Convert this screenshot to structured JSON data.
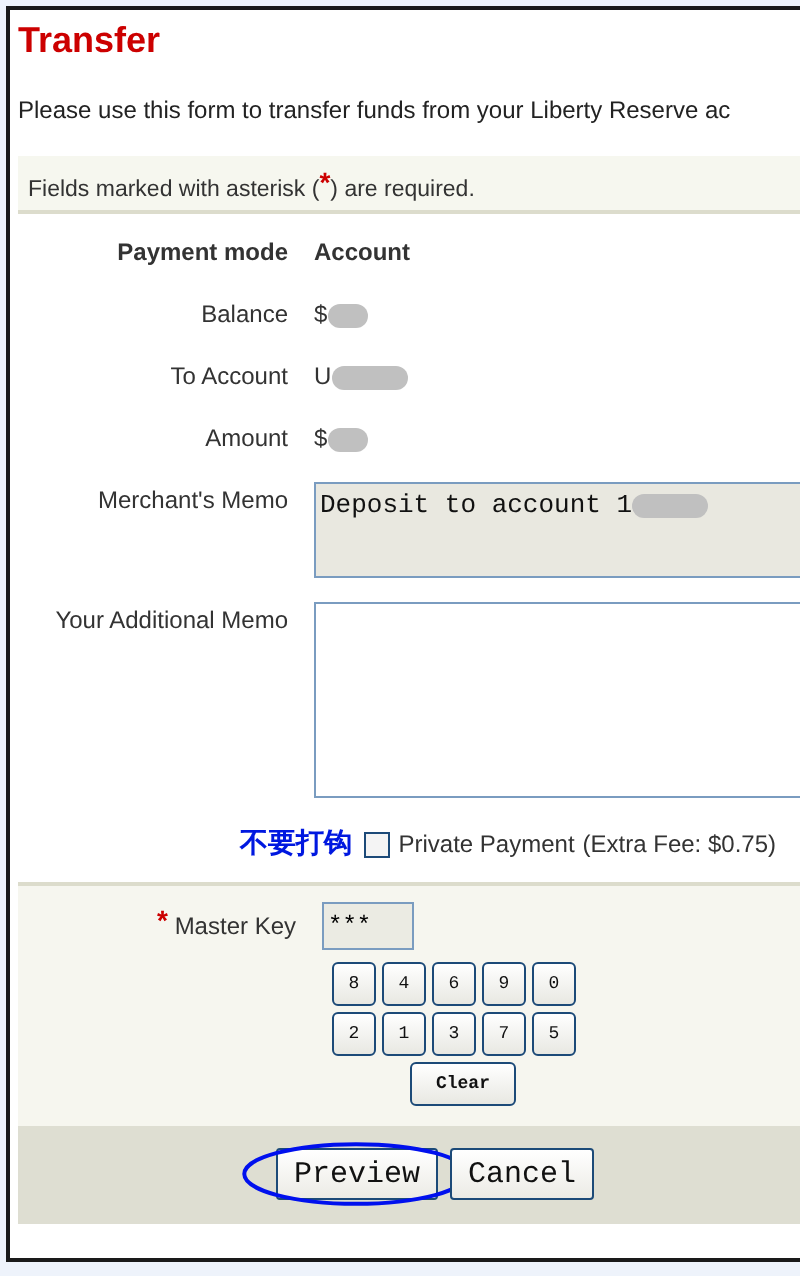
{
  "title": "Transfer",
  "intro": "Please use this form to transfer funds from your Liberty Reserve ac",
  "notice": {
    "before": "Fields marked with asterisk (",
    "mark": "*",
    "after": ") are required."
  },
  "fields": [
    {
      "kind": "heading",
      "label": "Payment mode",
      "value": "Account",
      "redacted": false
    },
    {
      "kind": "text",
      "label": "Balance",
      "value": "$",
      "redacted": true
    },
    {
      "kind": "text",
      "label": "To Account",
      "value": "U",
      "redacted": true
    },
    {
      "kind": "text",
      "label": "Amount",
      "value": "$",
      "redacted": true
    }
  ],
  "merchant_memo": {
    "label": "Merchant's Memo",
    "value": "Deposit to account 1",
    "redacted": true
  },
  "additional_memo": {
    "label": "Your Additional Memo"
  },
  "annotation": "不要打钩",
  "private_payment": {
    "label": "Private Payment",
    "checked": false,
    "fee": "(Extra Fee: $0.75)"
  },
  "master_key": {
    "required_mark": "*",
    "label": "Master Key",
    "value": "***"
  },
  "keypad": [
    [
      "8",
      "4",
      "6",
      "9",
      "0"
    ],
    [
      "2",
      "1",
      "3",
      "7",
      "5"
    ]
  ],
  "clear": "Clear",
  "buttons": [
    {
      "label": "Preview",
      "highlighted": true
    },
    {
      "label": "Cancel",
      "highlighted": false
    }
  ]
}
